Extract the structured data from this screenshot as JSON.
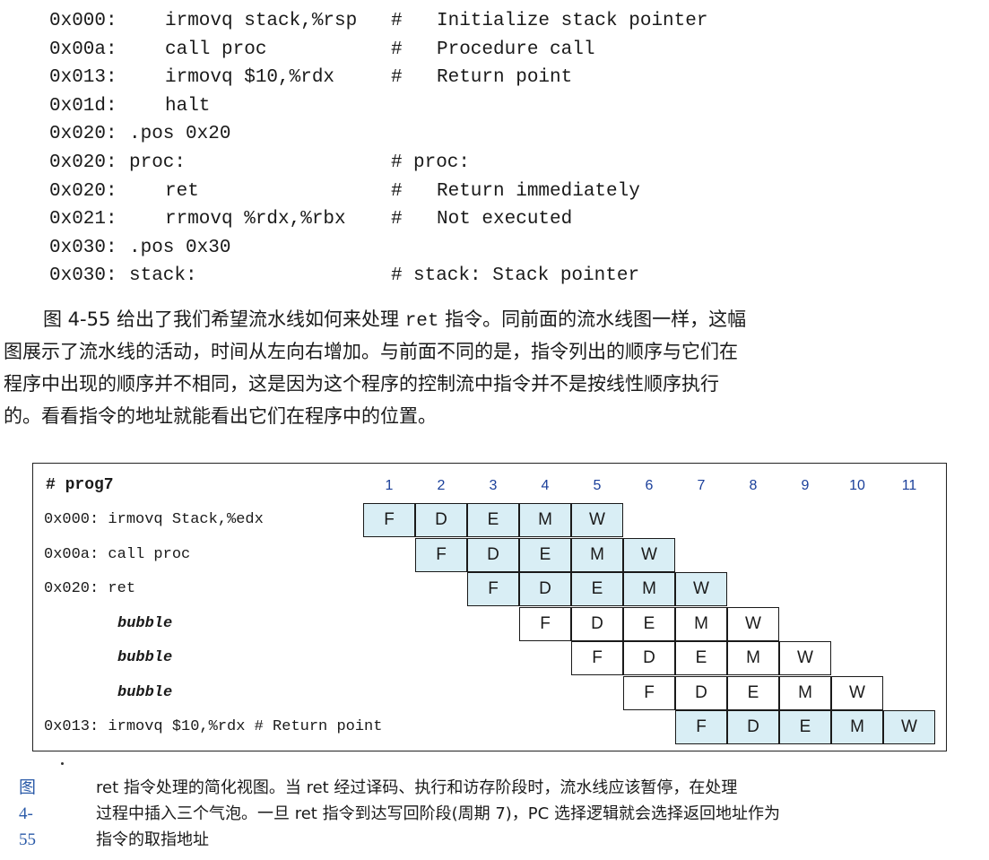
{
  "code": [
    {
      "addr": "0x000:",
      "instr": "irmovq stack,%rsp",
      "hash": "#",
      "comment": "Initialize stack pointer"
    },
    {
      "addr": "0x00a:",
      "instr": "call proc",
      "hash": "#",
      "comment": "Procedure call"
    },
    {
      "addr": "0x013:",
      "instr": "irmovq $10,%rdx",
      "hash": "#",
      "comment": "Return point"
    },
    {
      "addr": "0x01d:",
      "instr": "halt",
      "hash": "",
      "comment": ""
    },
    {
      "addr": "0x020:",
      "label": ".pos 0x20",
      "hash": "",
      "comment": ""
    },
    {
      "addr": "0x020:",
      "label": "proc:",
      "hash": "#",
      "comment": "proc:",
      "tight": true
    },
    {
      "addr": "0x020:",
      "instr": "ret",
      "hash": "#",
      "comment": "Return immediately"
    },
    {
      "addr": "0x021:",
      "instr": "rrmovq %rdx,%rbx",
      "hash": "#",
      "comment": "Not executed"
    },
    {
      "addr": "0x030:",
      "label": ".pos 0x30",
      "hash": "",
      "comment": ""
    },
    {
      "addr": "0x030:",
      "label": "stack:",
      "hash": "#",
      "comment": "stack: Stack pointer",
      "tight": true
    }
  ],
  "paragraph": {
    "line1_a": "图 4-55 给出了我们希望流水线如何来处理 ",
    "line1_code": "ret",
    "line1_b": " 指令。同前面的流水线图一样，这幅",
    "line2": "图展示了流水线的活动，时间从左向右增加。与前面不同的是，指令列出的顺序与它们在",
    "line3": "程序中出现的顺序并不相同，这是因为这个程序的控制流中指令并不是按线性顺序执行",
    "line4": "的。看看指令的地址就能看出它们在程序中的位置。"
  },
  "figure": {
    "title": "# prog7",
    "cycles": [
      "1",
      "2",
      "3",
      "4",
      "5",
      "6",
      "7",
      "8",
      "9",
      "10",
      "11"
    ],
    "stages": [
      "F",
      "D",
      "E",
      "M",
      "W"
    ],
    "rows": [
      {
        "label": "0x000: irmovq Stack,%edx",
        "start": 1,
        "kind": "instr"
      },
      {
        "label": "0x00a: call proc",
        "start": 2,
        "kind": "instr"
      },
      {
        "label": "0x020: ret",
        "start": 3,
        "kind": "instr"
      },
      {
        "label": "bubble",
        "start": 4,
        "kind": "bubble"
      },
      {
        "label": "bubble",
        "start": 5,
        "kind": "bubble"
      },
      {
        "label": "bubble",
        "start": 6,
        "kind": "bubble"
      },
      {
        "label": "0x013: irmovq $10,%rdx # Return point",
        "start": 7,
        "kind": "instr"
      }
    ],
    "colors": {
      "instr_fill": "#d9eef5",
      "cycle_number": "#1a3f9a"
    }
  },
  "caption": {
    "number": "图 4-55",
    "line1": "ret 指令处理的简化视图。当 ret 经过译码、执行和访存阶段时，流水线应该暂停，在处理",
    "line2": "过程中插入三个气泡。一旦 ret 指令到达写回阶段(周期 7)，PC 选择逻辑就会选择返回地址作为",
    "line3": "指令的取指地址"
  }
}
